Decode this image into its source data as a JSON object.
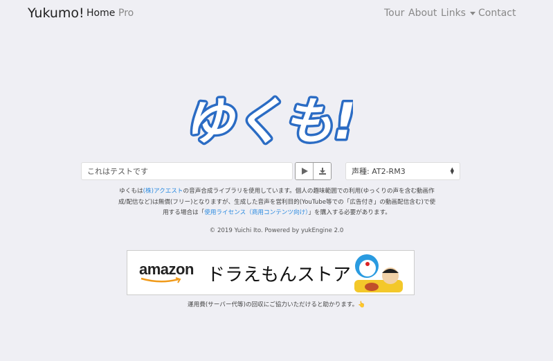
{
  "nav": {
    "brand": "Yukumo!",
    "left": [
      {
        "label": "Home",
        "active": true
      },
      {
        "label": "Pro",
        "active": false
      }
    ],
    "right": [
      {
        "label": "Tour"
      },
      {
        "label": "About"
      },
      {
        "label": "Links"
      },
      {
        "label": "Contact"
      }
    ]
  },
  "logo": {
    "text": "ゆくも!",
    "color": "#2b6cc4"
  },
  "form": {
    "text_value": "これはテストです",
    "play_icon": "play-icon",
    "download_icon": "download-icon",
    "voice_select": "声種: AT2-RM3"
  },
  "notice": {
    "p1": "ゆくもは",
    "link1": "(株)アクエスト",
    "p2": "の音声合成ライブラリを使用しています。個人の趣味範囲での利用(ゆっくりの声を含む動画作成/配信など)は無償(フリー)となりますが、生成した音声を営利目的(YouTube等での「広告付き」の動画配信含む)で使用する場合は「",
    "link2": "使用ライセンス（商用コンテンツ向け）",
    "p3": "」を購入する必要があります。"
  },
  "footer": {
    "copyright": "© 2019 Yuichi Ito. Powered by yukEngine 2.0"
  },
  "banner": {
    "brand": "amazon",
    "title": "ドラえもんストア"
  },
  "thanks": "運用費(サーバー代等)の回収にご協力いただけると助かります。👆"
}
